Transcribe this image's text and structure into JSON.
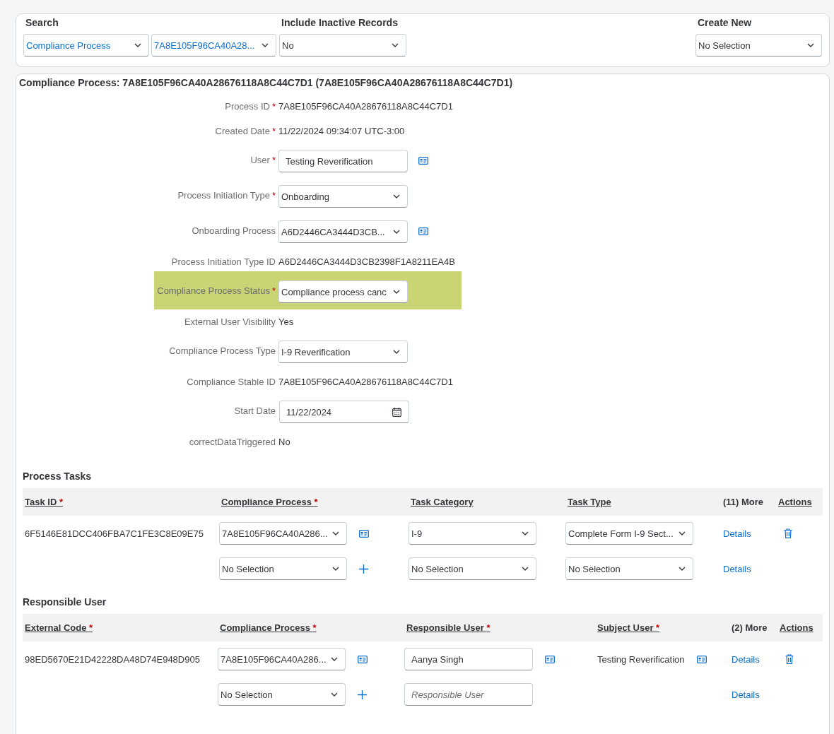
{
  "search_panel": {
    "search": {
      "label": "Search",
      "selects": [
        {
          "value": "Compliance Process"
        },
        {
          "value": "7A8E105F96CA40A28..."
        }
      ]
    },
    "include_inactive": {
      "label": "Include Inactive Records",
      "value": "No"
    },
    "create_new": {
      "label": "Create New",
      "value": "No Selection"
    }
  },
  "record": {
    "title": "Compliance Process: 7A8E105F96CA40A28676118A8C44C7D1 (7A8E105F96CA40A28676118A8C44C7D1)",
    "fields": [
      {
        "label": "Process ID",
        "required_mark": "*",
        "kind": "text",
        "value": "7A8E105F96CA40A28676118A8C44C7D1",
        "value_help": false,
        "highlighted": false
      },
      {
        "label": "Created Date",
        "required_mark": "*",
        "kind": "text",
        "value": "11/22/2024 09:34:07 UTC-3:00",
        "value_help": false,
        "highlighted": false
      },
      {
        "label": "User",
        "required_mark": "*",
        "kind": "input",
        "value": "Testing Reverification",
        "value_help": true,
        "highlighted": false
      },
      {
        "label": "Process Initiation Type",
        "required_mark": "*",
        "kind": "select",
        "value": "Onboarding",
        "value_help": false,
        "highlighted": false
      },
      {
        "label": "Onboarding Process",
        "kind": "select",
        "value": "A6D2446CA3444D3CB...",
        "value_help": true,
        "highlighted": false
      },
      {
        "label": "Process Initiation Type ID",
        "kind": "text",
        "value": "A6D2446CA3444D3CB2398F1A8211EA4B",
        "value_help": false,
        "highlighted": false
      },
      {
        "label": "Compliance Process Status",
        "required_mark": "*",
        "kind": "select",
        "value": "Compliance process canc",
        "value_help": false,
        "highlighted": true
      },
      {
        "label": "External User Visibility",
        "kind": "text",
        "value": "Yes",
        "value_help": false,
        "highlighted": false
      },
      {
        "label": "Compliance Process Type",
        "kind": "select",
        "value": "I-9 Reverification",
        "value_help": false,
        "highlighted": false
      },
      {
        "label": "Compliance Stable ID",
        "kind": "text",
        "value": "7A8E105F96CA40A28676118A8C44C7D1",
        "value_help": false,
        "highlighted": false
      },
      {
        "label": "Start Date",
        "kind": "date",
        "value": "11/22/2024",
        "value_help": false,
        "highlighted": false
      },
      {
        "label": "correctDataTriggered",
        "kind": "text",
        "value": "No",
        "value_help": false,
        "highlighted": false
      }
    ]
  },
  "process_tasks": {
    "title": "Process Tasks",
    "columns": [
      {
        "label": "Task ID",
        "required_mark": "*",
        "sortable": true
      },
      {
        "label": "Compliance Process",
        "required_mark": "*",
        "sortable": true
      },
      {
        "label": "Task Category",
        "sortable": true
      },
      {
        "label": "Task Type",
        "sortable": true
      },
      {
        "label": "(11) More",
        "sortable": false
      },
      {
        "label": "Actions",
        "sortable": true
      }
    ],
    "rows": [
      {
        "cells": [
          {
            "kind": "text",
            "value": "6F5146E81DCC406FBA7C1FE3C8E09E75",
            "value_help": false,
            "add": false
          },
          {
            "kind": "select",
            "value": "7A8E105F96CA40A286...",
            "value_help": true,
            "add": false
          },
          {
            "kind": "select",
            "value": "I-9",
            "value_help": false,
            "add": false
          },
          {
            "kind": "select",
            "value": "Complete Form I-9 Sect...",
            "value_help": false,
            "add": false
          },
          {
            "kind": "link",
            "value": "Details"
          },
          {
            "kind": "delete"
          }
        ]
      },
      {
        "cells": [
          {
            "kind": "empty"
          },
          {
            "kind": "select",
            "value": "No Selection",
            "value_help": false,
            "add": true
          },
          {
            "kind": "select",
            "value": "No Selection",
            "value_help": false,
            "add": false
          },
          {
            "kind": "select",
            "value": "No Selection",
            "value_help": false,
            "add": false
          },
          {
            "kind": "link",
            "value": "Details"
          },
          {
            "kind": "empty"
          }
        ]
      }
    ]
  },
  "responsible_user": {
    "title": "Responsible User",
    "columns": [
      {
        "label": "External Code",
        "required_mark": "*",
        "sortable": true
      },
      {
        "label": "Compliance Process",
        "required_mark": "*",
        "sortable": true
      },
      {
        "label": "Responsible User",
        "required_mark": "*",
        "sortable": true
      },
      {
        "label": "Subject User",
        "required_mark": "*",
        "sortable": true
      },
      {
        "label": "(2) More",
        "sortable": false
      },
      {
        "label": "Actions",
        "sortable": true
      }
    ],
    "rows": [
      {
        "cells": [
          {
            "kind": "text",
            "value": "98ED5670E21D42228DA48D74E948D905",
            "value_help": false,
            "add": false
          },
          {
            "kind": "select",
            "value": "7A8E105F96CA40A286...",
            "value_help": true,
            "add": false
          },
          {
            "kind": "input",
            "value": "Aanya Singh",
            "value_help": true,
            "add": false
          },
          {
            "kind": "text",
            "value": "Testing Reverification",
            "value_help": true,
            "add": false
          },
          {
            "kind": "link",
            "value": "Details"
          },
          {
            "kind": "delete"
          }
        ]
      },
      {
        "cells": [
          {
            "kind": "empty"
          },
          {
            "kind": "select",
            "value": "No Selection",
            "value_help": false,
            "add": true
          },
          {
            "kind": "input",
            "placeholder": "Responsible User",
            "value_help": false,
            "add": false
          },
          {
            "kind": "empty"
          },
          {
            "kind": "link",
            "value": "Details"
          },
          {
            "kind": "empty"
          }
        ]
      }
    ]
  }
}
